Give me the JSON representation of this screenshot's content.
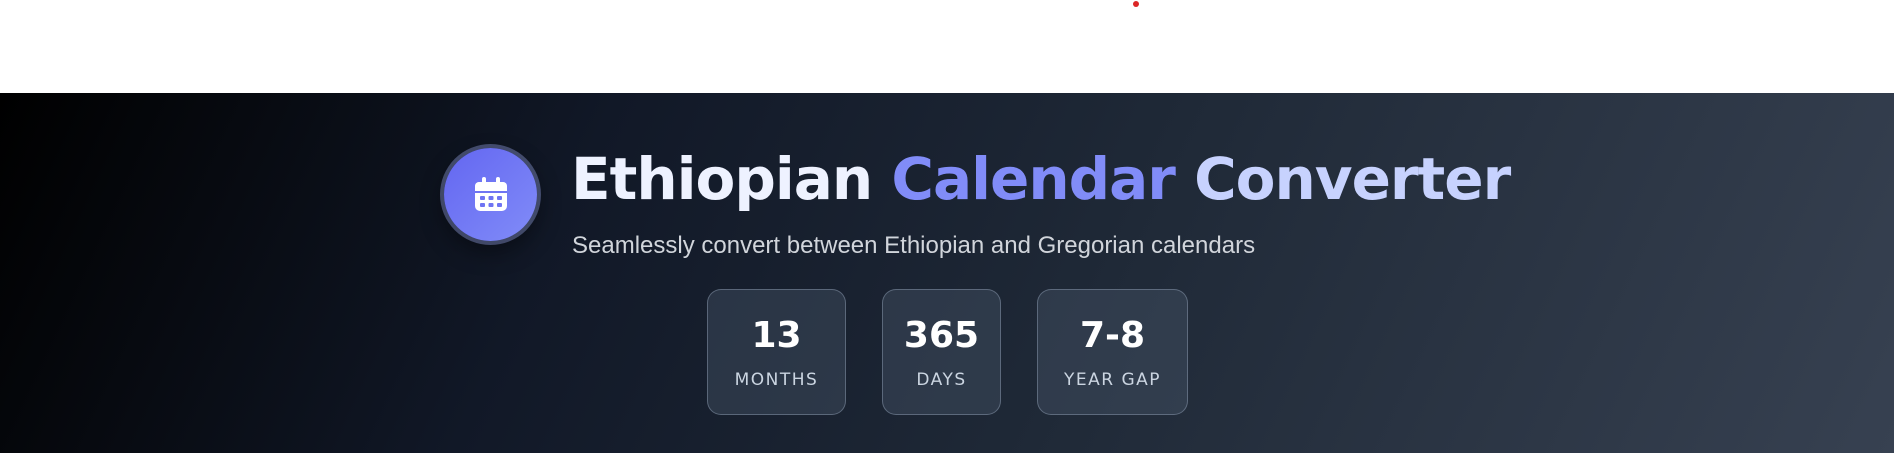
{
  "header": {
    "title_part1": "Ethiopian ",
    "title_part2": "Calendar",
    "title_part3": " Converter",
    "subtitle": "Seamlessly convert between Ethiopian and Gregorian calendars",
    "logo_icon": "calendar-icon"
  },
  "stats": [
    {
      "value": "13",
      "label": "MONTHS"
    },
    {
      "value": "365",
      "label": "DAYS"
    },
    {
      "value": "7-8",
      "label": "YEAR GAP"
    }
  ],
  "colors": {
    "accent": "#6366f1",
    "accent_light": "#818cf8",
    "hero_dark": "#000000",
    "hero_light": "#374151",
    "indicator": "#dc2626"
  }
}
